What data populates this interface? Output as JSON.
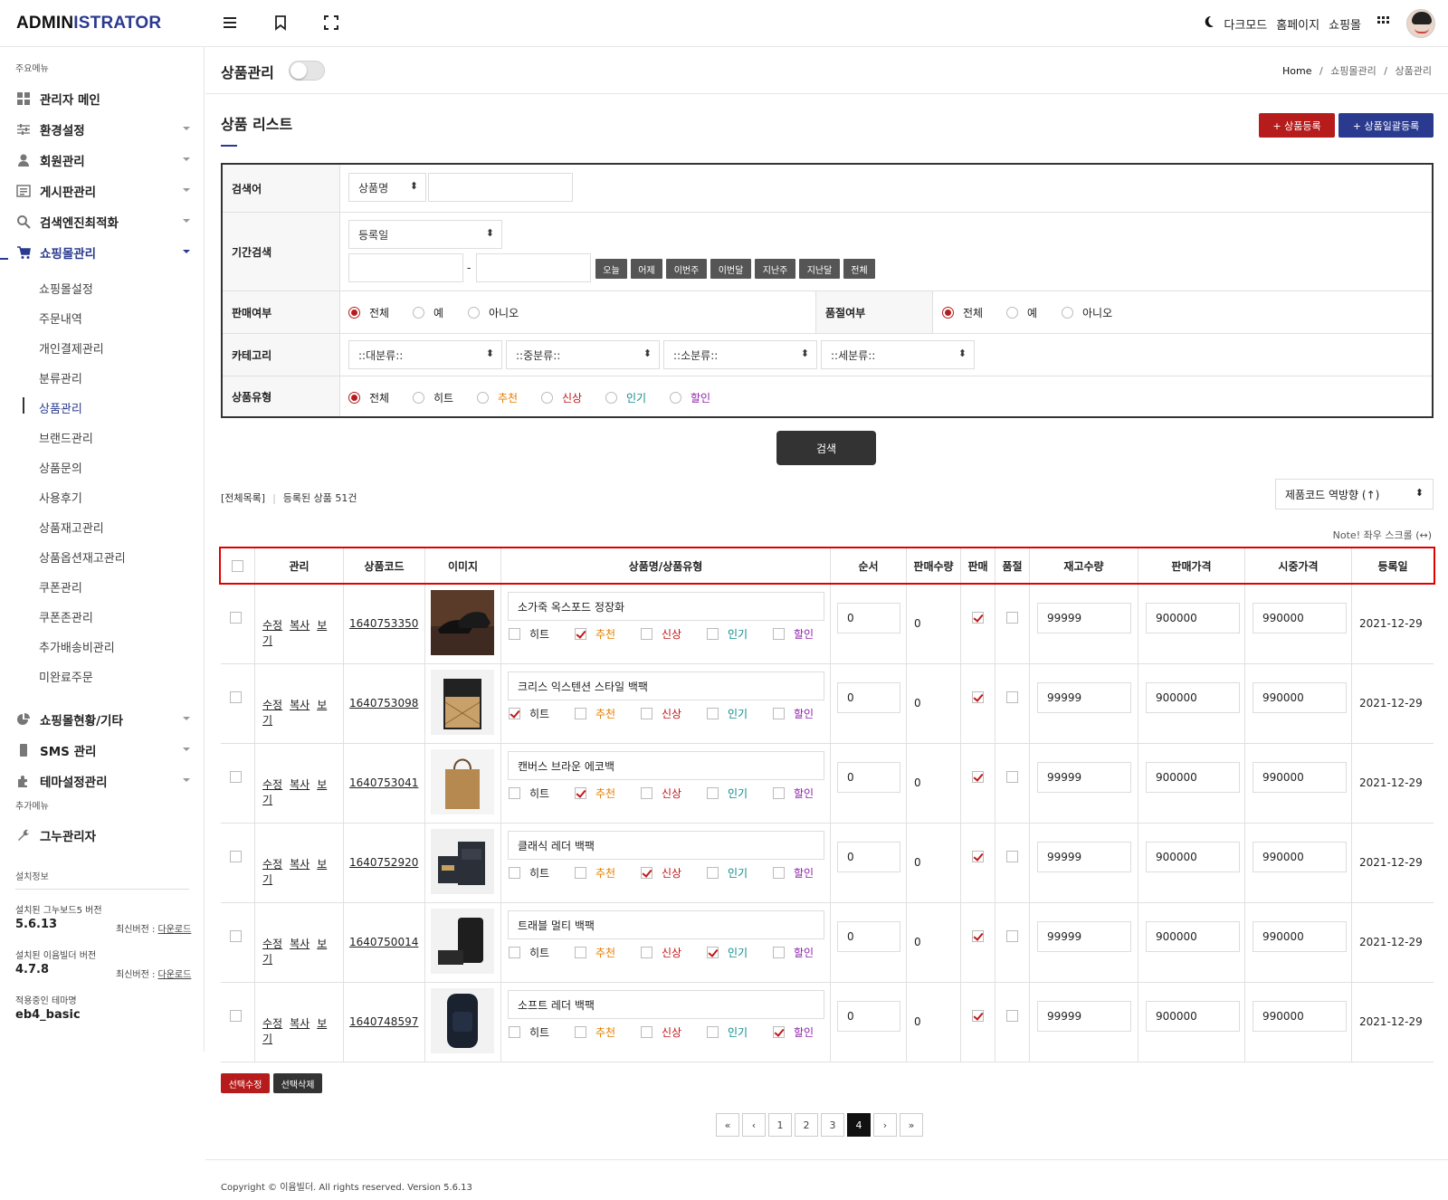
{
  "header": {
    "logo_a": "ADMIN",
    "logo_b": "ISTRATOR",
    "dark_mode": "다크모드",
    "homepage": "홈페이지",
    "shop": "쇼핑몰"
  },
  "sidebar": {
    "main_section": "주요메뉴",
    "menu": [
      {
        "label": "관리자 메인"
      },
      {
        "label": "환경설정"
      },
      {
        "label": "회원관리"
      },
      {
        "label": "게시판관리"
      },
      {
        "label": "검색엔진최적화"
      },
      {
        "label": "쇼핑몰관리"
      }
    ],
    "submenu": [
      "쇼핑몰설정",
      "주문내역",
      "개인결제관리",
      "분류관리",
      "상품관리",
      "브랜드관리",
      "상품문의",
      "사용후기",
      "상품재고관리",
      "상품옵션재고관리",
      "쿠폰관리",
      "쿠폰존관리",
      "추가배송비관리",
      "미완료주문"
    ],
    "menu2": [
      {
        "label": "쇼핑몰현황/기타"
      },
      {
        "label": "SMS 관리"
      },
      {
        "label": "테마설정관리"
      }
    ],
    "extra_section": "추가메뉴",
    "extra_item": "그누관리자",
    "install_section": "설치정보",
    "gnuboard_label": "설치된 그누보드5 버전",
    "gnuboard_version": "5.6.13",
    "latest_label": "최신버전 : ",
    "download": "다운로드",
    "eyoom_label": "설치된 이윰빌더 버전",
    "eyoom_version": "4.7.8",
    "theme_label": "적용중인 테마명",
    "theme_name": "eb4_basic"
  },
  "page": {
    "title": "상품관리",
    "breadcrumb_home": "Home",
    "breadcrumb_sep": "/",
    "breadcrumb_1": "쇼핑몰관리",
    "breadcrumb_2": "상품관리",
    "section_title": "상품 리스트",
    "add_button": "+ 상품등록",
    "bulk_button": "+ 상품일괄등록"
  },
  "search": {
    "keyword_label": "검색어",
    "keyword_select": "상품명",
    "period_label": "기간검색",
    "period_select": "등록일",
    "dash": "-",
    "date_buttons": [
      "오늘",
      "어제",
      "이번주",
      "이번달",
      "지난주",
      "지난달",
      "전체"
    ],
    "sale_label": "판매여부",
    "soldout_label": "품절여부",
    "yn_options": [
      "전체",
      "예",
      "아니오"
    ],
    "category_label": "카테고리",
    "categories": [
      "::대분류::",
      "::중분류::",
      "::소분류::",
      "::세분류::"
    ],
    "type_label": "상품유형",
    "type_options": [
      "전체",
      "히트",
      "추천",
      "신상",
      "인기",
      "할인"
    ],
    "submit": "검색"
  },
  "list": {
    "all_list": "[전체목록]",
    "sep": "|",
    "count_text": "등록된 상품 51건",
    "sort_select": "제품코드 역방향 (↑)",
    "note": "Note! 좌우 스크롤 (↔)",
    "headers": [
      "관리",
      "상품코드",
      "이미지",
      "상품명/상품유형",
      "순서",
      "판매수량",
      "판매",
      "품절",
      "재고수량",
      "판매가격",
      "시중가격",
      "등록일"
    ],
    "actions": [
      "수정",
      "복사",
      "보기"
    ],
    "type_labels": [
      "히트",
      "추천",
      "신상",
      "인기",
      "할인"
    ],
    "rows": [
      {
        "code": "1640753350",
        "name": "소가죽 옥스포드 정장화",
        "types": [
          false,
          true,
          false,
          false,
          false
        ],
        "order": "0",
        "sold": "0",
        "sale": true,
        "soldout": false,
        "stock": "99999",
        "price": "900000",
        "market": "990000",
        "date": "2021-12-29",
        "img": "shoes"
      },
      {
        "code": "1640753098",
        "name": "크리스 익스텐션 스타일 백팩",
        "types": [
          true,
          false,
          false,
          false,
          false
        ],
        "order": "0",
        "sold": "0",
        "sale": true,
        "soldout": false,
        "stock": "99999",
        "price": "900000",
        "market": "990000",
        "date": "2021-12-29",
        "img": "woven"
      },
      {
        "code": "1640753041",
        "name": "캔버스 브라운 에코백",
        "types": [
          false,
          true,
          false,
          false,
          false
        ],
        "order": "0",
        "sold": "0",
        "sale": true,
        "soldout": false,
        "stock": "99999",
        "price": "900000",
        "market": "990000",
        "date": "2021-12-29",
        "img": "tote"
      },
      {
        "code": "1640752920",
        "name": "클래식 레더 백팩",
        "types": [
          false,
          false,
          true,
          false,
          false
        ],
        "order": "0",
        "sold": "0",
        "sale": true,
        "soldout": false,
        "stock": "99999",
        "price": "900000",
        "market": "990000",
        "date": "2021-12-29",
        "img": "leather"
      },
      {
        "code": "1640750014",
        "name": "트래블 멀티 백팩",
        "types": [
          false,
          false,
          false,
          true,
          false
        ],
        "order": "0",
        "sold": "0",
        "sale": true,
        "soldout": false,
        "stock": "99999",
        "price": "900000",
        "market": "990000",
        "date": "2021-12-29",
        "img": "multi"
      },
      {
        "code": "1640748597",
        "name": "소프트 레더 백팩",
        "types": [
          false,
          false,
          false,
          false,
          true
        ],
        "order": "0",
        "sold": "0",
        "sale": true,
        "soldout": false,
        "stock": "99999",
        "price": "900000",
        "market": "990000",
        "date": "2021-12-29",
        "img": "soft"
      }
    ],
    "edit_selected": "선택수정",
    "delete_selected": "선택삭제"
  },
  "pagination": {
    "first": "«",
    "prev": "‹",
    "pages": [
      "1",
      "2",
      "3",
      "4"
    ],
    "current": "4",
    "next": "›",
    "last": "»"
  },
  "footer": {
    "text": "Copyright © 이윰빌더. All rights reserved. Version 5.6.13"
  },
  "colors": {
    "brand": "#2a3a8f",
    "danger": "#b71c1c",
    "highlight_border": "#e00000"
  }
}
